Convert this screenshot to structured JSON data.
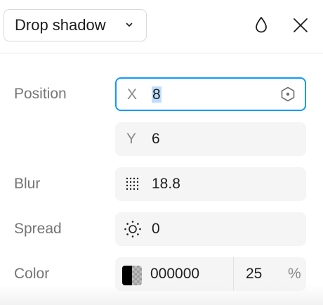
{
  "header": {
    "effect_type": "Drop shadow",
    "icons": [
      "chevron-down-icon",
      "blend-drop-icon",
      "close-icon"
    ]
  },
  "position": {
    "label": "Position",
    "x_prefix": "X",
    "x_value": "8",
    "y_prefix": "Y",
    "y_value": "6"
  },
  "blur": {
    "label": "Blur",
    "value": "18.8"
  },
  "spread": {
    "label": "Spread",
    "value": "0"
  },
  "color": {
    "label": "Color",
    "hex": "000000",
    "opacity": "25",
    "unit": "%",
    "swatch_color": "#000000"
  },
  "accent": "#0d99ff"
}
